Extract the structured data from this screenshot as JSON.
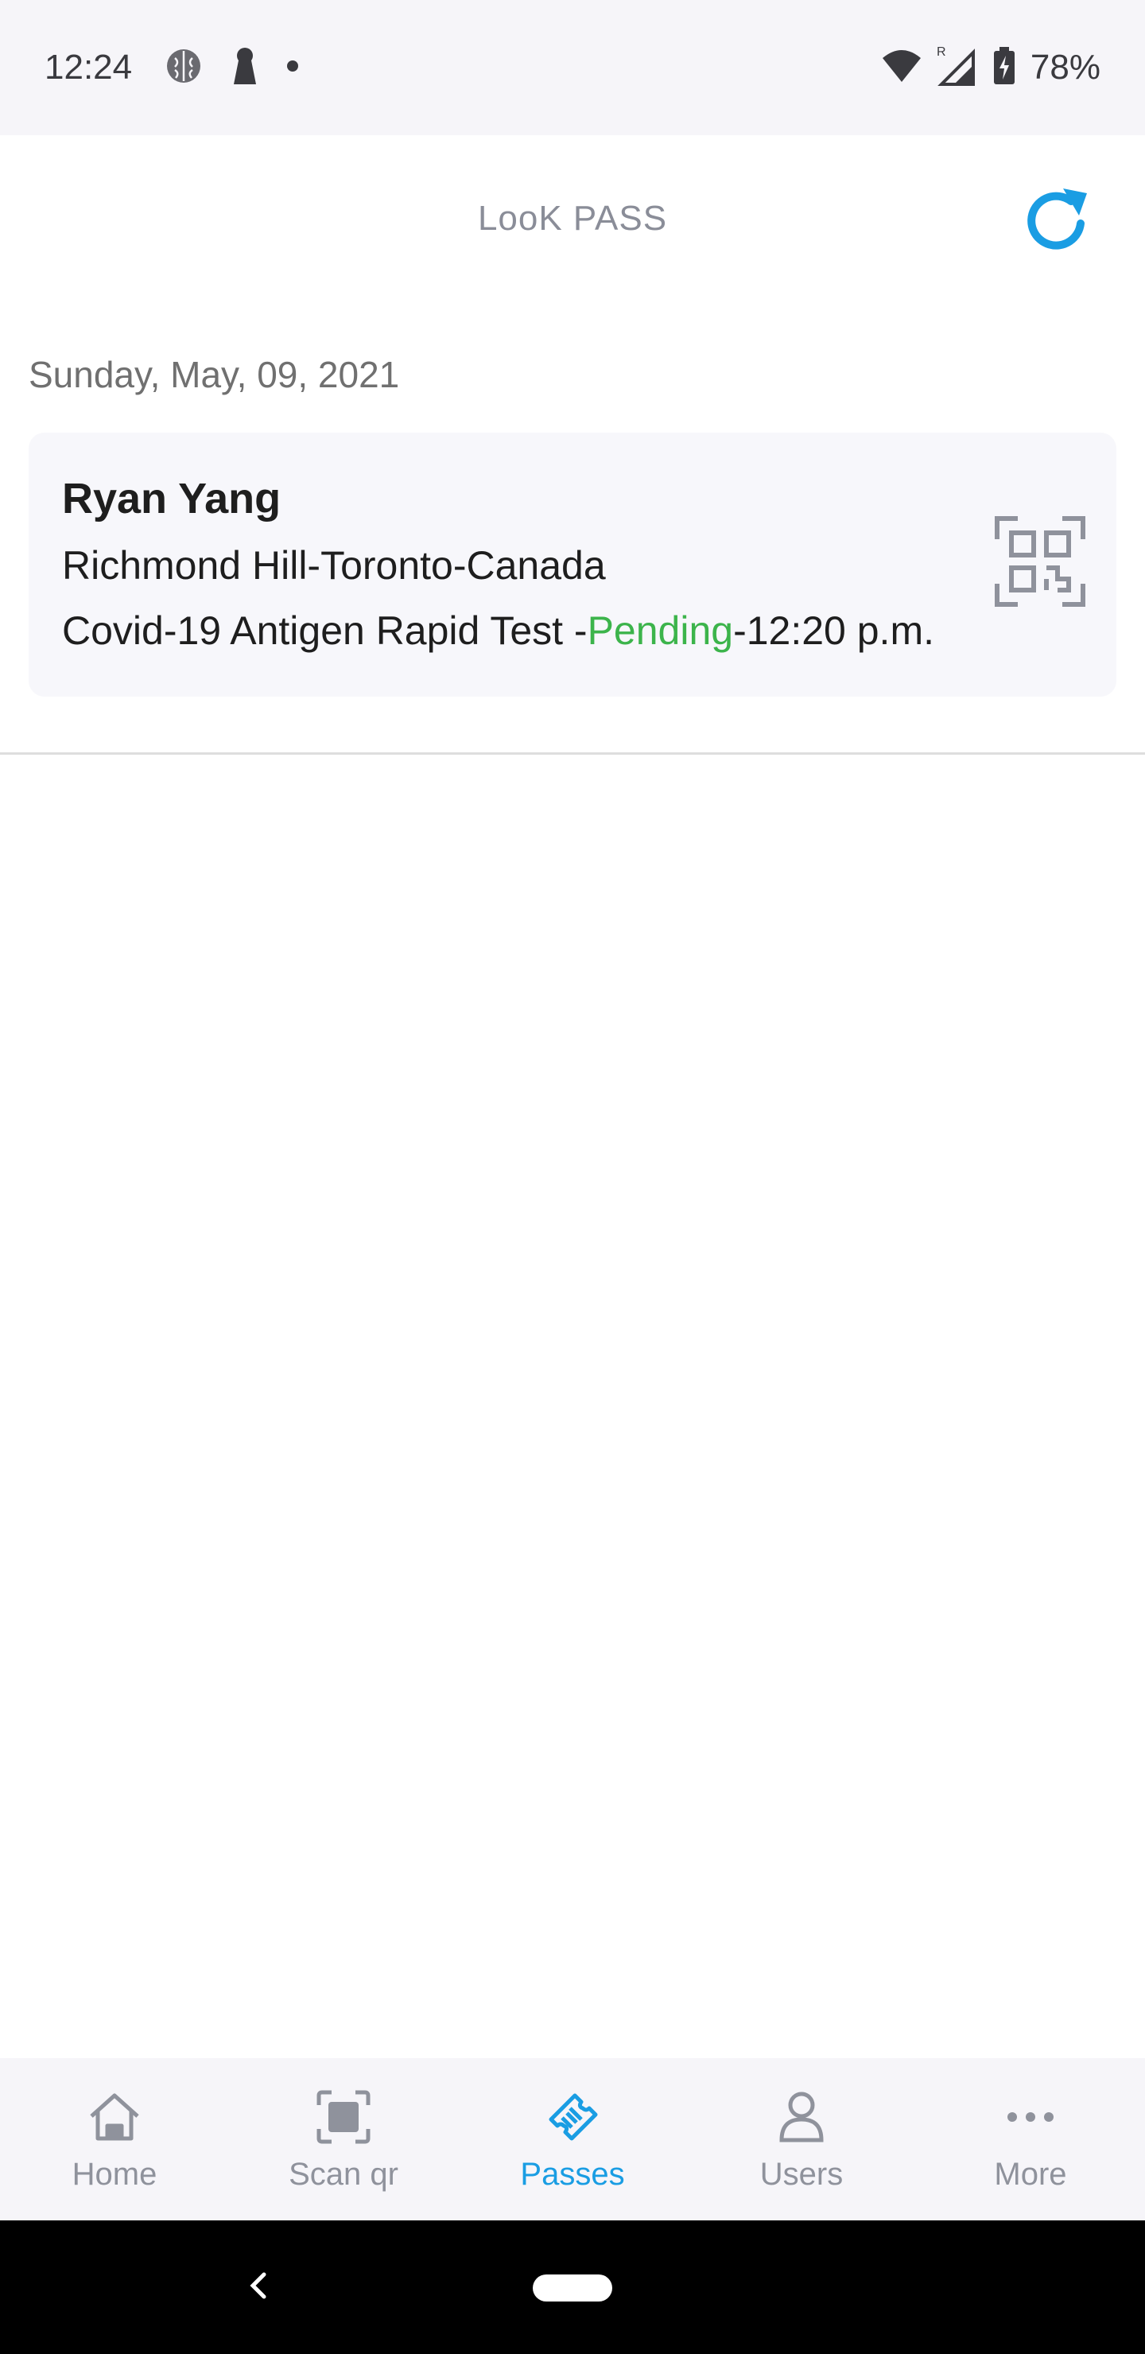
{
  "status_bar": {
    "time": "12:24",
    "battery_percent": "78%",
    "icons": [
      "brain-app-icon",
      "keyhole-app-icon",
      "notification-dot-icon",
      "wifi-icon",
      "signal-roaming-icon",
      "battery-charging-icon"
    ],
    "roaming_indicator": "R"
  },
  "header": {
    "title": "LooK PASS",
    "refresh_icon": "refresh-icon",
    "accent_color": "#1a9de3"
  },
  "passes": {
    "date": "Sunday, May, 09, 2021",
    "items": [
      {
        "name": "Ryan Yang",
        "location": "Richmond Hill-Toronto-Canada",
        "test_prefix": "Covid-19 Antigen Rapid Test -",
        "status": "Pending",
        "time_suffix": "-12:20 p.m.",
        "status_color": "#3cb44b",
        "icon": "qr-code-icon"
      }
    ]
  },
  "bottom_nav": {
    "active": "Passes",
    "items": [
      {
        "label": "Home",
        "icon": "home-icon"
      },
      {
        "label": "Scan qr",
        "icon": "scan-qr-icon"
      },
      {
        "label": "Passes",
        "icon": "ticket-icon"
      },
      {
        "label": "Users",
        "icon": "user-icon"
      },
      {
        "label": "More",
        "icon": "more-dots-icon"
      }
    ]
  }
}
